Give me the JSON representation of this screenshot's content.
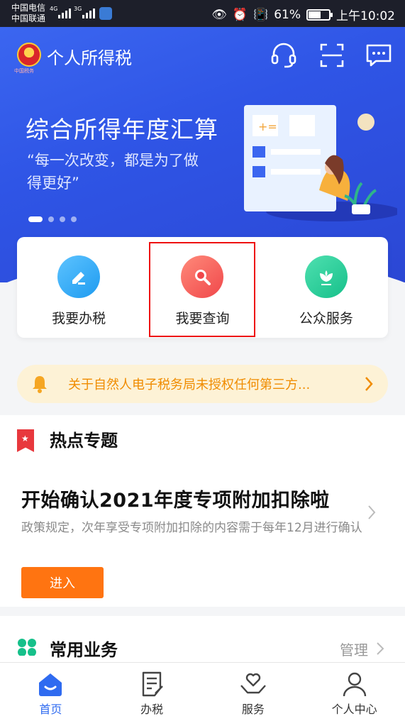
{
  "status_bar": {
    "carrier1": "中国电信",
    "carrier2": "中国联通",
    "net1": "4G",
    "net2": "3G",
    "battery": "61%",
    "battery_level": 0.61,
    "time": "上午10:02"
  },
  "header": {
    "emblem_text": "中国税务",
    "title": "个人所得税",
    "icons": [
      "headset-icon",
      "scan-icon",
      "message-icon"
    ]
  },
  "banner": {
    "title": "综合所得年度汇算",
    "quote": "“每一次改变，都是为了做得更好”",
    "slide_count": 4,
    "active_slide": 1
  },
  "actions": [
    {
      "label": "我要办税",
      "icon": "pen-icon",
      "color": "#1e9bf0"
    },
    {
      "label": "我要查询",
      "icon": "search-icon",
      "color": "#f0474a"
    },
    {
      "label": "公众服务",
      "icon": "flower-icon",
      "color": "#16c08a"
    }
  ],
  "notice": {
    "text": "关于自然人电子税务局未授权任何第三方..."
  },
  "hot_topics": {
    "section_title": "热点专题",
    "topic_title": "开始确认2021年度专项附加扣除啦",
    "topic_desc": "政策规定，次年享受专项附加扣除的内容需于每年12月进行确认",
    "button": "进入"
  },
  "common": {
    "section_title": "常用业务",
    "manage": "管理"
  },
  "tabs": [
    {
      "label": "首页",
      "icon": "home-icon",
      "active": true
    },
    {
      "label": "办税",
      "icon": "document-icon",
      "active": false
    },
    {
      "label": "服务",
      "icon": "heart-hands-icon",
      "active": false
    },
    {
      "label": "个人中心",
      "icon": "person-icon",
      "active": false
    }
  ],
  "colors": {
    "brand_blue": "#2f55e6",
    "accent_orange": "#ff7411",
    "tab_active": "#2f6bf0"
  }
}
